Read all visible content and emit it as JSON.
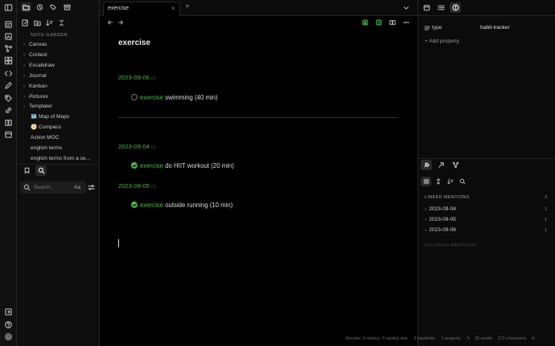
{
  "explorer": {
    "vault_name": "NOTE GARDEN",
    "items": [
      {
        "label": "Canvas",
        "type": "folder"
      },
      {
        "label": "Context",
        "type": "folder"
      },
      {
        "label": "Excalidraw",
        "type": "folder"
      },
      {
        "label": "Journal",
        "type": "folder"
      },
      {
        "label": "Kanban",
        "type": "folder"
      },
      {
        "label": "Pictures",
        "type": "folder"
      },
      {
        "label": "Templater",
        "type": "folder"
      },
      {
        "label": "🗺️ Map of Maps",
        "type": "file"
      },
      {
        "label": "🧭 Compass",
        "type": "file"
      },
      {
        "label": "Action MOC",
        "type": "file"
      },
      {
        "label": "english terms",
        "type": "file"
      },
      {
        "label": "english terms from a se...",
        "type": "file"
      }
    ]
  },
  "search": {
    "placeholder": "Search...",
    "match_case": "Aa"
  },
  "tab": {
    "title": "exercise"
  },
  "note": {
    "title": "exercise",
    "groups": [
      {
        "date": "2023-09-06",
        "count": "(1)",
        "tag": "exercise",
        "text": " swimming (40 min)",
        "done": false
      },
      {
        "date": "2023-09-04",
        "count": "(1)",
        "tag": "exercise",
        "text": " do HIIT workout (20 min)",
        "done": true
      },
      {
        "date": "2023-09-05",
        "count": "(1)",
        "tag": "exercise",
        "text": " outside running (10 min)",
        "done": true
      }
    ]
  },
  "properties": {
    "items": [
      {
        "key": "type",
        "value": "habit-tracker"
      }
    ],
    "add_label": "Add property"
  },
  "backlinks": {
    "linked_header": "LINKED MENTIONS",
    "linked_count": "3",
    "items": [
      {
        "label": "2023-09-04",
        "count": "1"
      },
      {
        "label": "2023-09-05",
        "count": "1"
      },
      {
        "label": "2023-09-06",
        "count": "1"
      }
    ],
    "unlinked_header": "UNLINKED MENTIONS"
  },
  "status_bar": {
    "review": "Review: 0 note(s), 0 card(s) due",
    "backlinks": "3 backlinks",
    "properties": "1 property",
    "words": "35 words",
    "characters": "273 characters"
  },
  "colors": {
    "accent": "#4cb84c",
    "background": "#000000"
  }
}
